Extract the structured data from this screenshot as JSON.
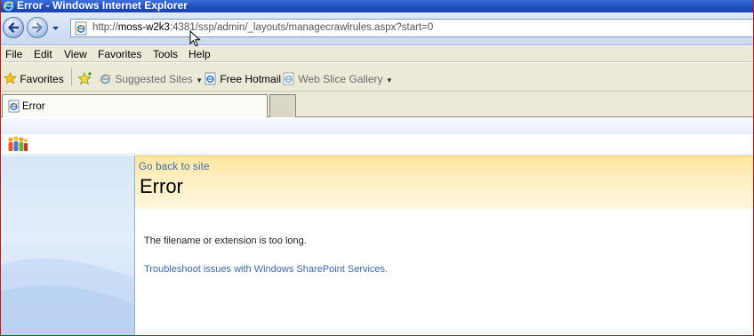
{
  "window": {
    "title": "Error - Windows Internet Explorer"
  },
  "address_bar": {
    "url_prefix": "http://",
    "url_host": "moss-w2k3",
    "url_rest": ":4381/ssp/admin/_layouts/managecrawlrules.aspx?start=0"
  },
  "menu": {
    "items": [
      "File",
      "Edit",
      "View",
      "Favorites",
      "Tools",
      "Help"
    ]
  },
  "favorites_bar": {
    "favorites_label": "Favorites",
    "suggested_sites": "Suggested Sites",
    "free_hotmail": "Free Hotmail",
    "web_slice_gallery": "Web Slice Gallery"
  },
  "tabs": {
    "active_tab": "Error"
  },
  "page": {
    "go_back_link": "Go back to site",
    "title": "Error",
    "message": "The filename or extension is too long.",
    "troubleshoot_link": "Troubleshoot issues with Windows SharePoint Services."
  },
  "colors": {
    "title_bar": "#1e4cc0",
    "header_band": "#fde69d",
    "link": "#3b6aa8",
    "left_nav": "#d6e6fa"
  },
  "icons": [
    "ie-icon",
    "back-arrow-icon",
    "forward-arrow-icon",
    "favorites-star-icon",
    "add-favorites-icon",
    "sharepoint-people-icon",
    "mouse-cursor-icon"
  ]
}
